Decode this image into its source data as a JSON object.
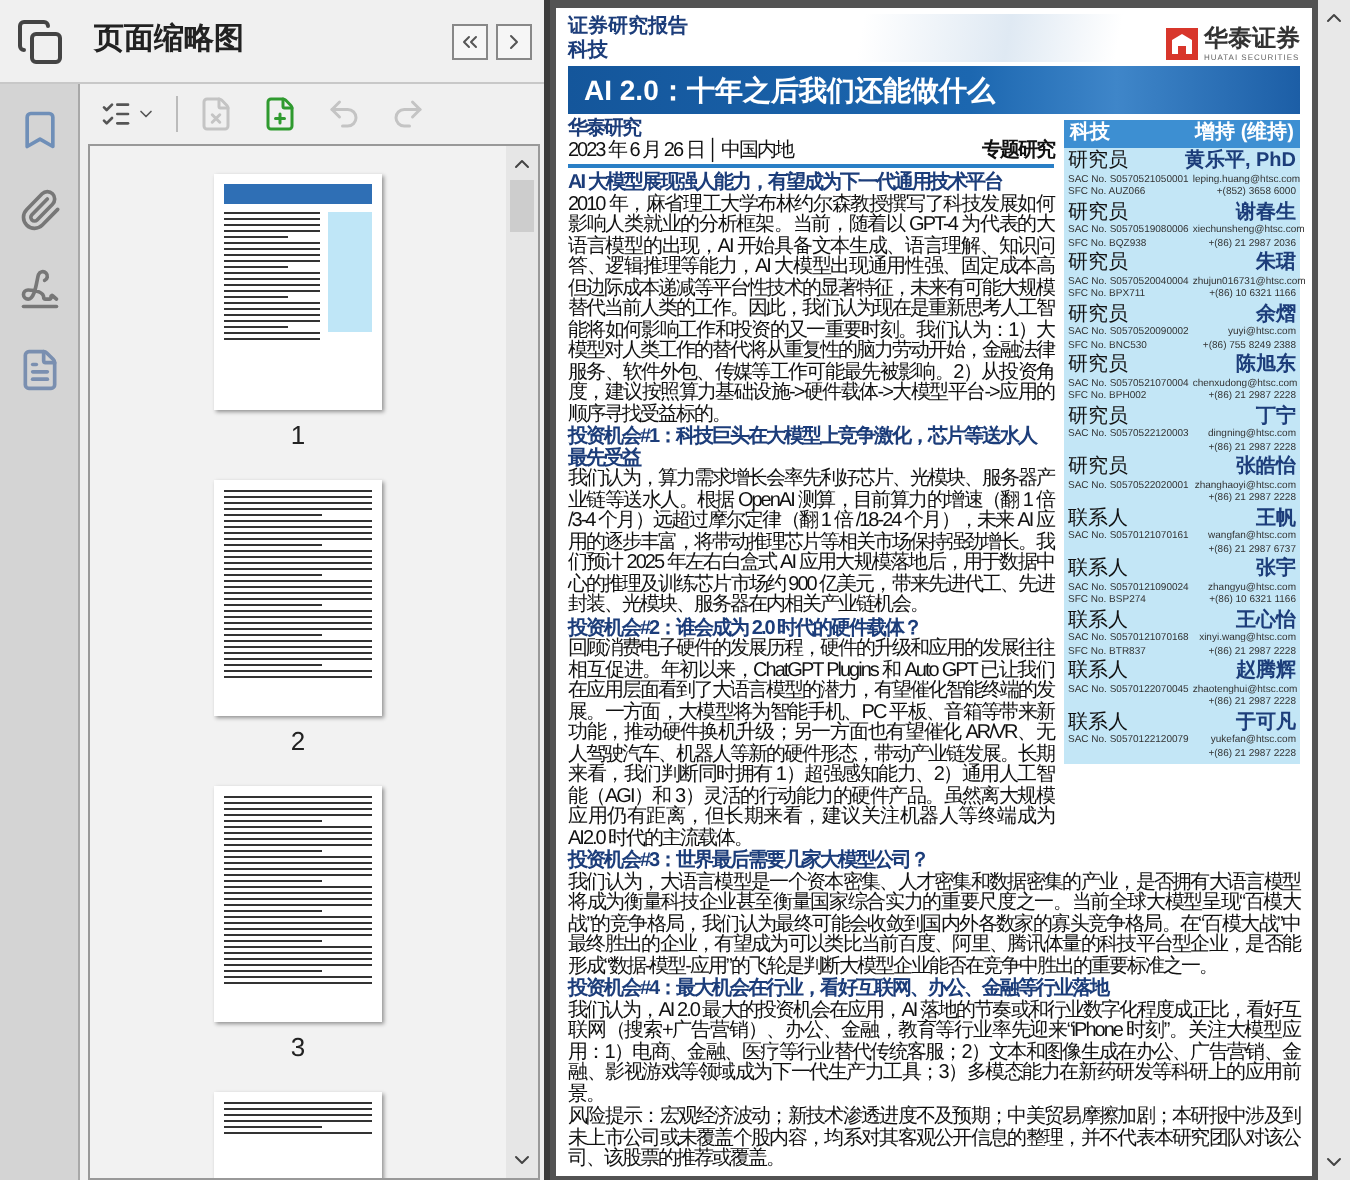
{
  "thumbnail_panel": {
    "title": "页面缩略图",
    "toolbar": [
      {
        "kind": "options",
        "disabled": false
      },
      {
        "kind": "delete",
        "disabled": true
      },
      {
        "kind": "insert",
        "disabled": false
      },
      {
        "kind": "undo",
        "disabled": true
      },
      {
        "kind": "redo",
        "disabled": true
      }
    ],
    "thumbnails": [
      {
        "kind": "cover",
        "label": "1"
      },
      {
        "kind": "contents",
        "label": "2"
      },
      {
        "kind": "contents",
        "label": "3"
      },
      {
        "kind": "partial"
      }
    ]
  },
  "document": {
    "report_label": "证券研究报告",
    "sector": "科技",
    "logo": {
      "name": "华泰证券",
      "subtitle": "HUATAI SECURITIES"
    },
    "title": "AI 2.0：十年之后我们还能做什么",
    "source": "华泰研究",
    "date_line": "2023 年 6 月 26 日 │ 中国内地",
    "report_type": "专题研究",
    "rating_box": {
      "sector": "科技",
      "rating": "增持 (维持)"
    },
    "contacts": [
      {
        "role": "研究员",
        "name": "黄乐平, PhD",
        "sac": "SAC No. S0570521050001",
        "sfc": "SFC No. AUZ066",
        "email": "leping.huang@htsc.com",
        "phone": "+(852) 3658 6000"
      },
      {
        "role": "研究员",
        "name": "谢春生",
        "sac": "SAC No. S0570519080006",
        "sfc": "SFC No. BQZ938",
        "email": "xiechunsheng@htsc.com",
        "phone": "+(86) 21 2987 2036"
      },
      {
        "role": "研究员",
        "name": "朱珺",
        "sac": "SAC No. S0570520040004",
        "sfc": "SFC No. BPX711",
        "email": "zhujun016731@htsc.com",
        "phone": "+(86) 10 6321 1166"
      },
      {
        "role": "研究员",
        "name": "余熠",
        "sac": "SAC No. S0570520090002",
        "sfc": "SFC No. BNC530",
        "email": "yuyi@htsc.com",
        "phone": "+(86) 755 8249 2388"
      },
      {
        "role": "研究员",
        "name": "陈旭东",
        "sac": "SAC No. S0570521070004",
        "sfc": "SFC No. BPH002",
        "email": "chenxudong@htsc.com",
        "phone": "+(86) 21 2987 2228"
      },
      {
        "role": "研究员",
        "name": "丁宁",
        "sac": "SAC No. S0570522120003",
        "email": "dingning@htsc.com",
        "phone": "+(86) 21 2987 2228"
      },
      {
        "role": "研究员",
        "name": "张皓怡",
        "sac": "SAC No. S0570522020001",
        "email": "zhanghaoyi@htsc.com",
        "phone": "+(86) 21 2987 2228"
      },
      {
        "role": "联系人",
        "name": "王帆",
        "sac": "SAC No. S0570121070161",
        "email": "wangfan@htsc.com",
        "phone": "+(86) 21 2987 6737"
      },
      {
        "role": "联系人",
        "name": "张宇",
        "sac": "SAC No. S0570121090024",
        "sfc": "SFC No. BSP274",
        "email": "zhangyu@htsc.com",
        "phone": "+(86) 10 6321 1166"
      },
      {
        "role": "联系人",
        "name": "王心怡",
        "sac": "SAC No. S0570121070168",
        "sfc": "SFC No. BTR837",
        "email": "xinyi.wang@htsc.com",
        "phone": "+(86) 21 2987 2228"
      },
      {
        "role": "联系人",
        "name": "赵腾辉",
        "sac": "SAC No. S0570122070045",
        "email": "zhaotenghui@htsc.com",
        "phone": "+(86) 21 2987 2228"
      },
      {
        "role": "联系人",
        "name": "于可凡",
        "sac": "SAC No. S0570122120079",
        "email": "yukefan@htsc.com",
        "phone": "+(86) 21 2987 2228"
      }
    ],
    "sections": [
      {
        "heading": "AI 大模型展现强人能力，有望成为下一代通用技术平台",
        "body": "2010 年，麻省理工大学布林约尔森教授撰写了科技发展如何影响人类就业的分析框架。当前，随着以 GPT-4 为代表的大语言模型的出现，AI 开始具备文本生成、语言理解、知识问答、逻辑推理等能力，AI 大模型出现通用性强、固定成本高但边际成本递减等平台性技术的显著特征，未来有可能大规模替代当前人类的工作。因此，我们认为现在是重新思考人工智能将如何影响工作和投资的又一重要时刻。我们认为：1）大模型对人类工作的替代将从重复性的脑力劳动开始，金融法律服务、软件外包、传媒等工作可能最先被影响。2）从投资角度，建议按照算力基础设施->硬件载体->大模型平台->应用的顺序寻找受益标的。"
      },
      {
        "heading": "投资机会#1：科技巨头在大模型上竞争激化，芯片等送水人最先受益",
        "body": "我们认为，算力需求增长会率先利好芯片、光模块、服务器产业链等送水人。根据 OpenAI 测算，目前算力的增速（翻 1 倍 /3-4 个月）远超过摩尔定律（翻 1 倍 /18-24 个月），未来 AI 应用的逐步丰富，将带动推理芯片等相关市场保持强劲增长。我们预计 2025 年左右白盒式 AI 应用大规模落地后，用于数据中心的推理及训练芯片市场约 900 亿美元，带来先进代工、先进封装、光模块、服务器在内相关产业链机会。"
      },
      {
        "heading": "投资机会#2：谁会成为 2.0 时代的硬件载体？",
        "body": "回顾消费电子硬件的发展历程，硬件的升级和应用的发展往往相互促进。年初以来，ChatGPT Plugins 和 Auto GPT 已让我们在应用层面看到了大语言模型的潜力，有望催化智能终端的发展。一方面，大模型将为智能手机、PC 平板、音箱等带来新功能，推动硬件换机升级；另一方面也有望催化 AR/VR、无人驾驶汽车、机器人等新的硬件形态，带动产业链发展。长期来看，我们判断同时拥有 1）超强感知能力、2）通用人工智能（AGI）和 3）灵活的行动能力的硬件产品。虽然离大规模应用仍有距离，但长期来看，建议关注机器人等终端成为 AI2.0 时代的主流载体。"
      },
      {
        "heading": "投资机会#3：世界最后需要几家大模型公司？",
        "body": "我们认为，大语言模型是一个资本密集、人才密集和数据密集的产业，是否拥有大语言模型将成为衡量科技企业甚至衡量国家综合实力的重要尺度之一。当前全球大模型呈现“百模大战”的竞争格局，我们认为最终可能会收敛到国内外各数家的寡头竞争格局。在“百模大战”中最终胜出的企业，有望成为可以类比当前百度、阿里、腾讯体量的科技平台型企业，是否能形成“数据-模型-应用”的飞轮是判断大模型企业能否在竞争中胜出的重要标准之一。"
      },
      {
        "heading": "投资机会#4：最大机会在行业，看好互联网、办公、金融等行业落地",
        "body": "我们认为，AI 2.0 最大的投资机会在应用，AI 落地的节奏或和行业数字化程度成正比，看好互联网（搜索+广告营销）、办公、金融，教育等行业率先迎来“iPhone 时刻”。关注大模型应用：1）电商、金融、医疗等行业替代传统客服；2）文本和图像生成在办公、广告营销、金融、影视游戏等领域成为下一代生产力工具；3）多模态能力在新药研发等科研上的应用前景。"
      }
    ],
    "risk": "风险提示：宏观经济波动；新技术渗透进度不及预期；中美贸易摩擦加剧；本研报中涉及到未上市公司或未覆盖个股内容，均系对其客观公开信息的整理，并不代表本研究团队对该公司、该股票的推荐或覆盖。"
  }
}
